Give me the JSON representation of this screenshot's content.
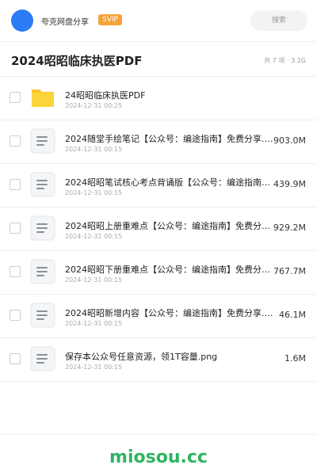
{
  "header": {
    "user_name": "夸克网盘分享",
    "badge": "SVIP",
    "search_placeholder": "搜索",
    "avatar_color": "#2b7cf6",
    "badge_color": "#f5a23a"
  },
  "folder": {
    "title": "2024昭昭临床执医PDF",
    "meta": "共 7 项 · 3.1G"
  },
  "files": [
    {
      "icon": "folder-icon",
      "name": "24昭昭临床执医PDF",
      "date": "2024-12-31 00:25",
      "size": ""
    },
    {
      "icon": "document-icon",
      "name": "2024随堂手绘笔记【公众号：编途指南】免费分享.zip",
      "date": "2024-12-31 00:15",
      "size": "903.0M"
    },
    {
      "icon": "document-icon",
      "name": "2024昭昭笔试核心考点背诵版【公众号：编途指南】免费分享.zip",
      "date": "2024-12-31 00:15",
      "size": "439.9M"
    },
    {
      "icon": "document-icon",
      "name": "2024昭昭上册重难点【公众号：编途指南】免费分享.zip",
      "date": "2024-12-31 00:15",
      "size": "929.2M"
    },
    {
      "icon": "document-icon",
      "name": "2024昭昭下册重难点【公众号：编途指南】免费分享.zip",
      "date": "2024-12-31 00:15",
      "size": "767.7M"
    },
    {
      "icon": "document-icon",
      "name": "2024昭昭新增内容【公众号：编途指南】免费分享.zip",
      "date": "2024-12-31 00:15",
      "size": "46.1M"
    },
    {
      "icon": "document-icon",
      "name": "保存本公众号任意资源，领1T容量.png",
      "date": "2024-12-31 00:15",
      "size": "1.6M"
    }
  ],
  "footer": {
    "brand": "miosou.cc",
    "brand_color": "#2fb463"
  }
}
